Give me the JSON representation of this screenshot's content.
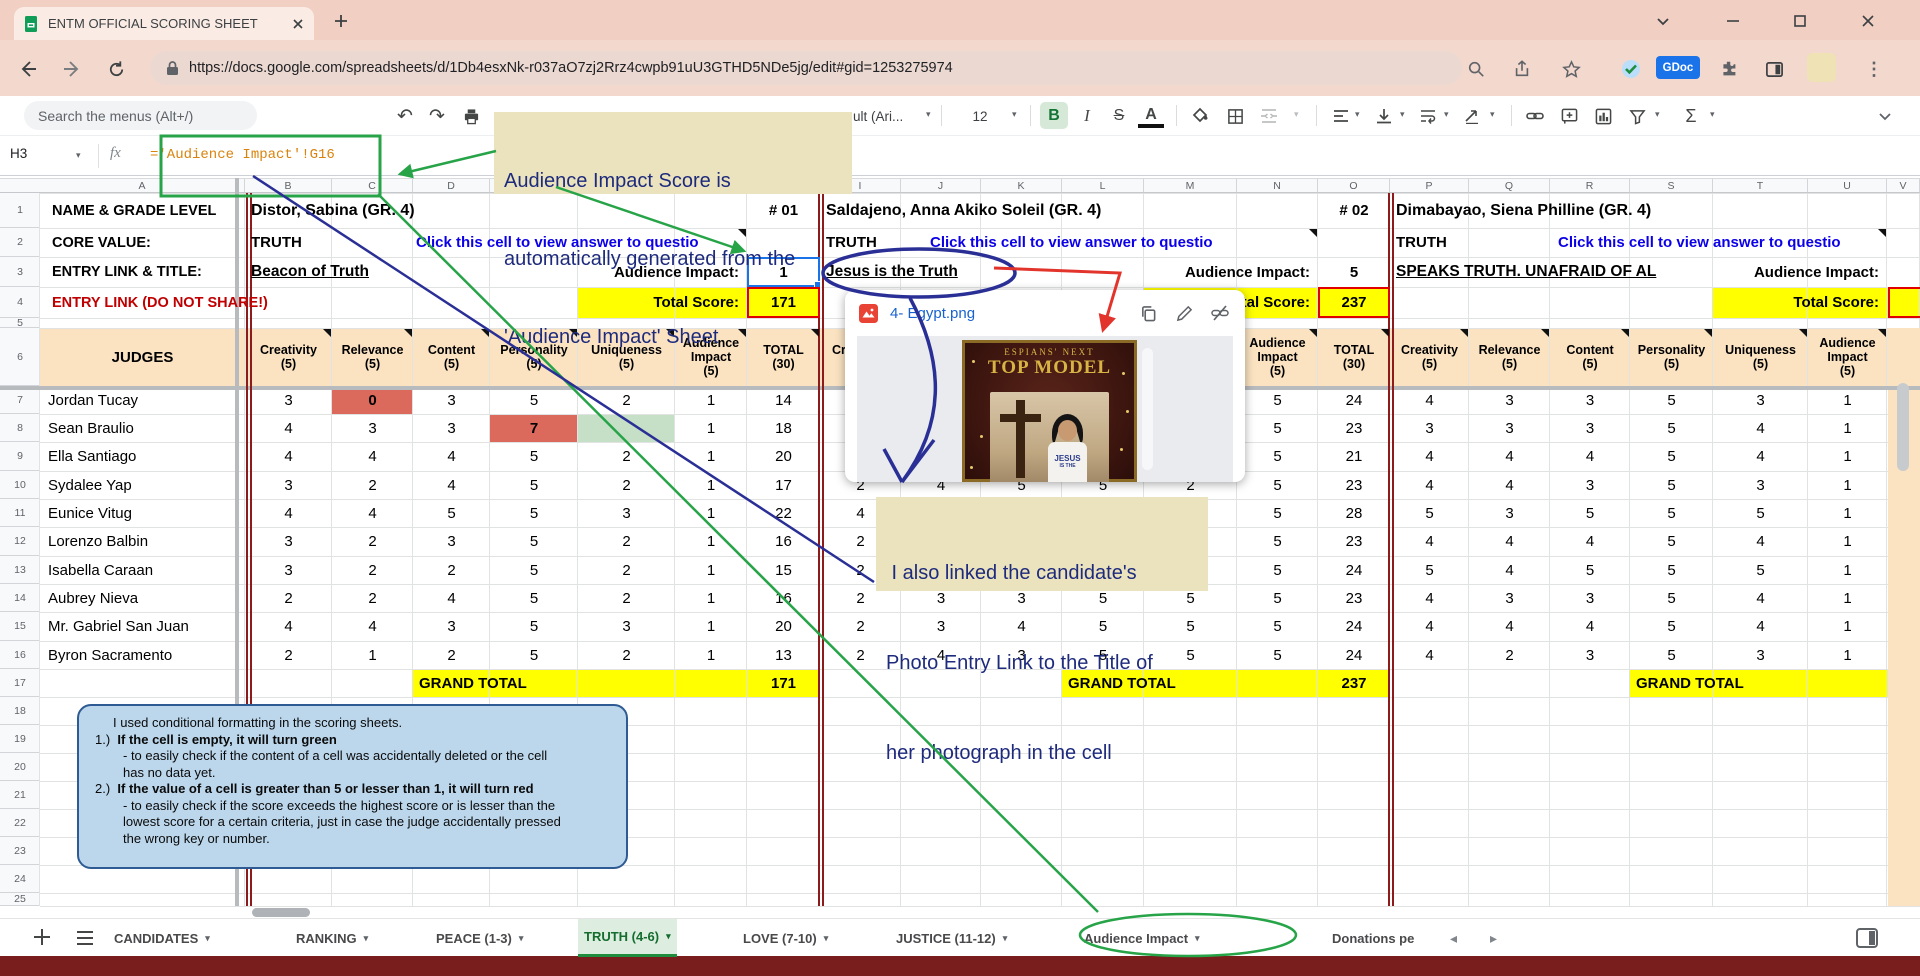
{
  "colors": {
    "annotation-green": "#27A348",
    "annotation-navy": "#2A2F96",
    "annotation-red": "#E2342B",
    "note-bg": "#EBE3BD",
    "note-text": "#1E2B7D",
    "bubble-bg": "#BCD7EC",
    "bubble-border": "#2F5B94",
    "tan": "#FBE3C2",
    "yellow": "#FFFF00",
    "red-cell": "#DB6A5D",
    "green-cell": "#C5E0C6",
    "maroon": "#8E1B1B",
    "link-blue": "#0B00E8"
  },
  "browser": {
    "tab_title": "ENTM OFFICIAL SCORING SHEET",
    "url": "https://docs.google.com/spreadsheets/d/1Db4esxNk-r037aO7zj2Rrz4cwpb91uU3GTHD5NDe5jg/edit#gid=1253275974",
    "gdoc_badge": "GDoc"
  },
  "toolbar": {
    "search_placeholder": "Search the menus (Alt+/)",
    "font_label": "ult (Ari...",
    "font_size": "12",
    "bold_label": "B",
    "italic_label": "I",
    "strike_label": "S",
    "color_label": "A",
    "sum_label": "Σ"
  },
  "formula_bar": {
    "name_box": "H3",
    "fx": "fx",
    "formula": "='Audience Impact'!G16"
  },
  "annotations": {
    "note_top": [
      "Audience Impact Score is",
      "automatically generated from the",
      "'Audience Impact' Sheet"
    ],
    "note_photo": [
      " I also linked the candidate's",
      "Photo Entry Link to the Title of",
      "her photograph in the cell"
    ],
    "bubble_lines": [
      {
        "indent": 18,
        "segments": [
          {
            "text": "I used conditional formatting in the scoring sheets.",
            "bold": false
          }
        ]
      },
      {
        "indent": 0,
        "segments": [
          {
            "text": "1.)  ",
            "bold": false
          },
          {
            "text": "If the cell is empty, it will turn green",
            "bold": true
          }
        ]
      },
      {
        "indent": 28,
        "segments": [
          {
            "text": "- to easily check if the content of a cell was accidentally deleted or the cell",
            "bold": false
          }
        ]
      },
      {
        "indent": 28,
        "segments": [
          {
            "text": "has no data yet.",
            "bold": false
          }
        ]
      },
      {
        "indent": 0,
        "segments": [
          {
            "text": "2.)  ",
            "bold": false
          },
          {
            "text": "If the value of a cell is greater than 5 or lesser than 1, it will turn red",
            "bold": true
          }
        ]
      },
      {
        "indent": 28,
        "segments": [
          {
            "text": "- to easily check if the score exceeds the highest score or is lesser than the",
            "bold": false
          }
        ]
      },
      {
        "indent": 28,
        "segments": [
          {
            "text": "lowest score for a certain criteria, just in case the judge accidentally pressed",
            "bold": false
          }
        ]
      },
      {
        "indent": 28,
        "segments": [
          {
            "text": "the wrong key or number.",
            "bold": false
          }
        ]
      }
    ]
  },
  "preview_card": {
    "filename": "4- Egypt.png",
    "poster_line1": "ESPIANS' NEXT",
    "poster_line2": "TOP MODEL",
    "shirt_line1": "JESUS",
    "shirt_line2": "IS THE"
  },
  "sheet": {
    "labels": {
      "name": "NAME & GRADE LEVEL",
      "core": "CORE VALUE:",
      "entry": "ENTRY LINK & TITLE:",
      "entry_link": "ENTRY LINK (DO NOT SHARE!)",
      "judges": "JUDGES",
      "grand_total": "GRAND TOTAL",
      "audience_impact": "Audience Impact:",
      "total_score": "Total Score:",
      "click_note": "Click this cell to view answer to questio"
    },
    "criteria": [
      "Creativity\n(5)",
      "Relevance\n(5)",
      "Content\n(5)",
      "Personality\n(5)",
      "Uniqueness\n(5)",
      "Audience\nImpact\n(5)",
      "TOTAL\n(30)"
    ],
    "judges": [
      "Jordan Tucay",
      "Sean Braulio",
      "Ella Santiago",
      "Sydalee Yap",
      "Eunice Vitug",
      "Lorenzo Balbin",
      "Isabella Caraan",
      "Aubrey Nieva",
      "Mr. Gabriel San Juan",
      "Byron Sacramento"
    ],
    "sections": [
      {
        "candidate": "Distor, Sabina (GR. 4)",
        "number": "# 01",
        "core_value": "TRUTH",
        "entry_title": "Beacon of Truth",
        "audience_impact": "1",
        "total_score": "171",
        "grand_total": "171",
        "rows": [
          [
            "3",
            {
              "v": "0",
              "bg": "red"
            },
            "3",
            "5",
            "2",
            "1",
            "14"
          ],
          [
            "4",
            "3",
            "3",
            {
              "v": "7",
              "bg": "red"
            },
            {
              "v": "",
              "bg": "green"
            },
            "1",
            "18"
          ],
          [
            "4",
            "4",
            "4",
            "5",
            "2",
            "1",
            "20"
          ],
          [
            "3",
            "2",
            "4",
            "5",
            "2",
            "1",
            "17"
          ],
          [
            "4",
            "4",
            "5",
            "5",
            "3",
            "1",
            "22"
          ],
          [
            "3",
            "2",
            "3",
            "5",
            "2",
            "1",
            "16"
          ],
          [
            "3",
            "2",
            "2",
            "5",
            "2",
            "1",
            "15"
          ],
          [
            "2",
            "2",
            "4",
            "5",
            "2",
            "1",
            "16"
          ],
          [
            "4",
            "4",
            "3",
            "5",
            "3",
            "1",
            "20"
          ],
          [
            "2",
            "1",
            "2",
            "5",
            "2",
            "1",
            "13"
          ]
        ]
      },
      {
        "candidate": "Saldajeno, Anna Akiko Soleil (GR. 4)",
        "number": "# 02",
        "core_value": "TRUTH",
        "entry_title": "Jesus is the Truth",
        "audience_impact": "5",
        "total_score": "237",
        "grand_total": "237",
        "rows": [
          [
            null,
            null,
            null,
            null,
            null,
            "5",
            "24"
          ],
          [
            null,
            null,
            null,
            null,
            null,
            "5",
            "23"
          ],
          [
            null,
            null,
            null,
            null,
            null,
            "5",
            "21"
          ],
          [
            "2",
            "4",
            "5",
            "5",
            "2",
            "5",
            "23"
          ],
          [
            "4",
            null,
            null,
            null,
            null,
            "5",
            "28"
          ],
          [
            "2",
            null,
            null,
            null,
            null,
            "5",
            "23"
          ],
          [
            "2",
            null,
            null,
            null,
            null,
            "5",
            "24"
          ],
          [
            "2",
            "3",
            "3",
            "5",
            "5",
            "5",
            "23"
          ],
          [
            "2",
            "3",
            "4",
            "5",
            "5",
            "5",
            "24"
          ],
          [
            "2",
            "4",
            "3",
            "5",
            "5",
            "5",
            "24"
          ]
        ]
      },
      {
        "candidate": "Dimabayao, Siena Philline  (GR. 4)",
        "number": null,
        "core_value": "TRUTH",
        "entry_title": "SPEAKS TRUTH. UNAFRAID OF AL",
        "audience_impact": null,
        "total_score": null,
        "grand_total": null,
        "rows": [
          [
            "4",
            "3",
            "3",
            "5",
            "3",
            "1"
          ],
          [
            "3",
            "3",
            "3",
            "5",
            "4",
            "1"
          ],
          [
            "4",
            "4",
            "4",
            "5",
            "4",
            "1"
          ],
          [
            "4",
            "4",
            "3",
            "5",
            "3",
            "1"
          ],
          [
            "5",
            "3",
            "5",
            "5",
            "5",
            "1"
          ],
          [
            "4",
            "4",
            "4",
            "5",
            "4",
            "1"
          ],
          [
            "5",
            "4",
            "5",
            "5",
            "5",
            "1"
          ],
          [
            "4",
            "3",
            "3",
            "5",
            "4",
            "1"
          ],
          [
            "4",
            "4",
            "4",
            "5",
            "4",
            "1"
          ],
          [
            "4",
            "2",
            "3",
            "5",
            "3",
            "1"
          ]
        ]
      }
    ]
  },
  "tabs": {
    "items": [
      {
        "label": "CANDIDATES"
      },
      {
        "label": "RANKING"
      },
      {
        "label": "PEACE (1-3)"
      },
      {
        "label": "TRUTH (4-6)"
      },
      {
        "label": "LOVE (7-10)"
      },
      {
        "label": "JUSTICE (11-12)"
      },
      {
        "label": "Audience Impact"
      },
      {
        "label": "Donations pe"
      }
    ]
  }
}
